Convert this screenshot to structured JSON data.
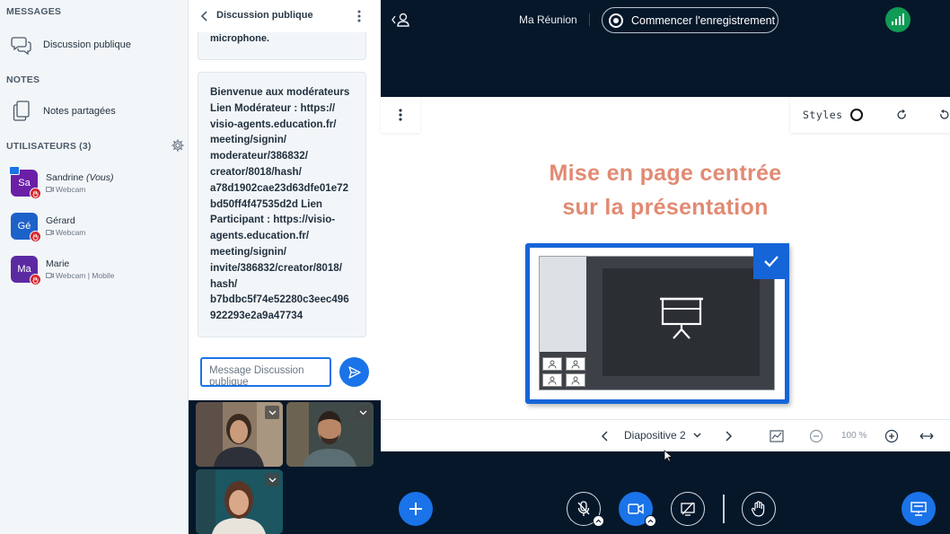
{
  "sidebar": {
    "messages_heading": "MESSAGES",
    "public_chat_label": "Discussion publique",
    "notes_heading": "NOTES",
    "shared_notes_label": "Notes partagées",
    "users_heading": "UTILISATEURS (3)",
    "users": [
      {
        "initials": "Sa",
        "name": "Sandrine",
        "tag": "(Vous)",
        "status": "Webcam",
        "color": "#6a1fa6"
      },
      {
        "initials": "Gé",
        "name": "Gérard",
        "tag": "",
        "status": "Webcam",
        "color": "#1d62c9"
      },
      {
        "initials": "Ma",
        "name": "Marie",
        "tag": "",
        "status": "Webcam | Mobile",
        "color": "#5b2aa3"
      }
    ]
  },
  "chat": {
    "title": "Discussion publique",
    "prev_message_fragment": "microphone.",
    "message": "Bienvenue aux modérateurs\nLien Modérateur : https://\nvisio-agents.education.fr/\nmeeting/signin/\nmoderateur/386832/\ncreator/8018/hash/\na78d1902cae23d63dfe01e72\nbd50ff4f47535d2d Lien\nParticipant : https://visio-\nagents.education.fr/\nmeeting/signin/\ninvite/386832/creator/8018/\nhash/\nb7bdbc5f74e52280c3eec496\n922293e2a9a47734",
    "input_placeholder": "Message Discussion publique"
  },
  "topbar": {
    "meeting_title": "Ma Réunion",
    "record_label": "Commencer l'enregistrement"
  },
  "presentation": {
    "styles_label": "Styles",
    "slide_title_line1": "Mise en page centrée",
    "slide_title_line2": "sur la présentation",
    "slide_selector": "Diapositive 2",
    "zoom": "100 %"
  },
  "colors": {
    "accent": "#1a73e8",
    "dark_bg": "#06172a",
    "hand_raise": "#d6262d",
    "connection": "#0f9b56",
    "slide_title": "#e18a73"
  }
}
